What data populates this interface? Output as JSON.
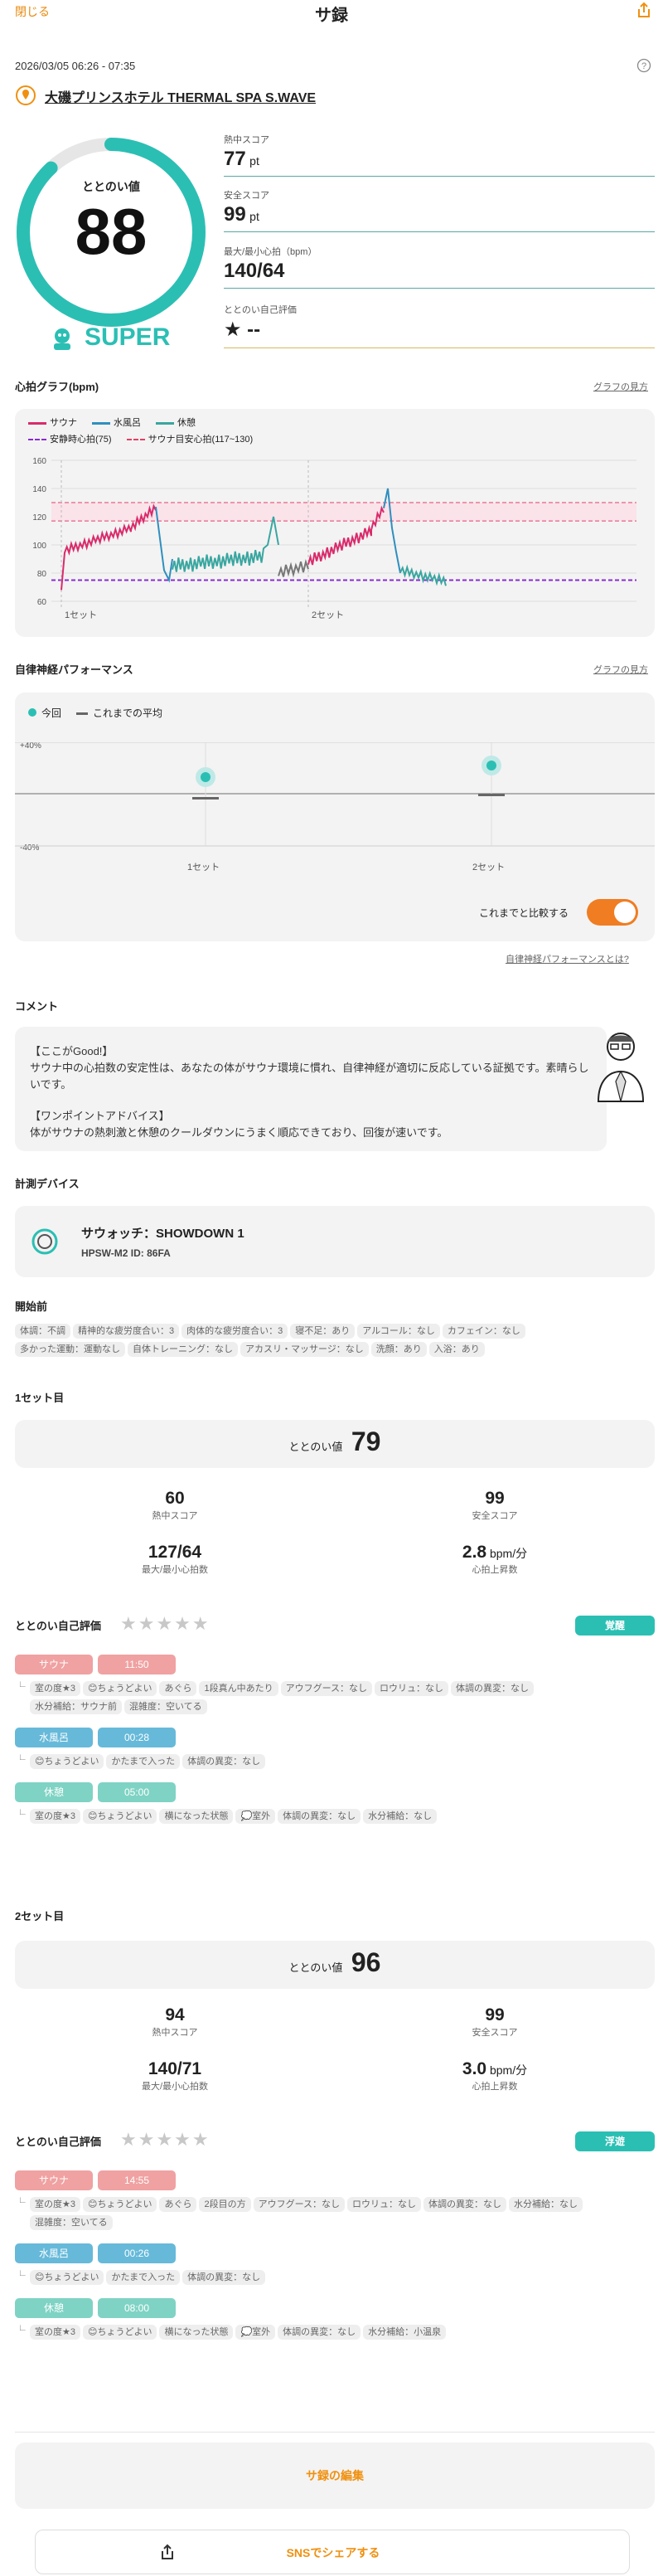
{
  "header": {
    "close": "閉じる",
    "title": "サ録"
  },
  "session": {
    "datetime": "2026/03/05 06:26 - 07:35",
    "facility": "大磯プリンスホテル THERMAL SPA S.WAVE"
  },
  "totonoi": {
    "label": "ととのい値",
    "value": "88",
    "rank": "SUPER",
    "progress": 0.88
  },
  "scores": [
    {
      "label": "熱中スコア",
      "value": "77",
      "unit": "pt",
      "color": "#5aa8a4"
    },
    {
      "label": "安全スコア",
      "value": "99",
      "unit": "pt",
      "color": "#5aa8a4"
    },
    {
      "label": "最大/最小心拍（bpm）",
      "value": "140/64",
      "unit": "",
      "color": "#5aa8a4"
    },
    {
      "label": "ととのい自己評価",
      "value": "★ --",
      "unit": "",
      "color": "#d8b85e"
    }
  ],
  "hr_graph": {
    "title": "心拍グラフ(bpm)",
    "help": "グラフの見方",
    "legend": {
      "sauna": "サウナ",
      "water": "水風呂",
      "rest": "休憩",
      "stable": "安静時心拍(75)",
      "target": "サウナ目安心拍(117~130)"
    },
    "y_ticks": [
      "160",
      "140",
      "120",
      "100",
      "80",
      "60"
    ],
    "set_labels": [
      "1セット",
      "2セット"
    ]
  },
  "ans": {
    "title": "自律神経パフォーマンス",
    "help": "グラフの見方",
    "legend_now": "今回",
    "legend_avg": "これまでの平均",
    "y_top": "+40%",
    "y_bottom": "-40%",
    "sets": [
      "1セット",
      "2セット"
    ],
    "compare": "これまでと比較する",
    "what": "自律神経パフォーマンスとは?"
  },
  "comment": {
    "title": "コメント",
    "good_head": "【ここがGood!】",
    "good_body": "サウナ中の心拍数の安定性は、あなたの体がサウナ環境に慣れ、自律神経が適切に反応している証拠です。素晴らしいです。",
    "advice_head": "【ワンポイントアドバイス】",
    "advice_body": "体がサウナの熱刺激と休憩のクールダウンにうまく順応できており、回復が速いです。"
  },
  "device": {
    "title": "計測デバイス",
    "name": "サウォッチ：SHOWDOWN 1",
    "id": "HPSW-M2  ID: 86FA"
  },
  "before": {
    "title": "開始前",
    "tags": [
      "体調：不調",
      "精神的な疲労度合い：3",
      "肉体的な疲労度合い：3",
      "寝不足：あり",
      "アルコール：なし",
      "カフェイン：なし",
      "多かった運動：運動なし",
      "自体トレーニング：なし",
      "アカスリ・マッサージ：なし",
      "洗顔：あり",
      "入浴：あり"
    ]
  },
  "set1": {
    "title": "1セット目",
    "totonoi_label": "ととのい値",
    "totonoi": "79",
    "stats": [
      {
        "value": "60",
        "unit": "",
        "label": "熱中スコア"
      },
      {
        "value": "99",
        "unit": "",
        "label": "安全スコア"
      },
      {
        "value": "127/64",
        "unit": "",
        "label": "最大/最小心拍数"
      },
      {
        "value": "2.8",
        "unit": " bpm/分",
        "label": "心拍上昇数"
      }
    ],
    "eval_label": "ととのい自己評価",
    "badge": "覚醒",
    "phases": [
      {
        "name": "サウナ",
        "time": "11:50",
        "color": "#f0a1a1",
        "tags": [
          "室の度★3",
          "😊ちょうどよい",
          "あぐら",
          "1段真ん中あたり",
          "アウフグース：なし",
          "ロウリュ：なし",
          "体調の異変：なし",
          "水分補給：サウナ前",
          "混雑度：空いてる"
        ]
      },
      {
        "name": "水風呂",
        "time": "00:28",
        "color": "#66b9d9",
        "tags": [
          "😊ちょうどよい",
          "かたまで入った",
          "体調の異変：なし"
        ]
      },
      {
        "name": "休憩",
        "time": "05:00",
        "color": "#7fd3c4",
        "tags": [
          "室の度★3",
          "😊ちょうどよい",
          "横になった状態",
          "💭室外",
          "体調の異変：なし",
          "水分補給：なし"
        ]
      }
    ]
  },
  "set2": {
    "title": "2セット目",
    "totonoi_label": "ととのい値",
    "totonoi": "96",
    "stats": [
      {
        "value": "94",
        "unit": "",
        "label": "熱中スコア"
      },
      {
        "value": "99",
        "unit": "",
        "label": "安全スコア"
      },
      {
        "value": "140/71",
        "unit": "",
        "label": "最大/最小心拍数"
      },
      {
        "value": "3.0",
        "unit": " bpm/分",
        "label": "心拍上昇数"
      }
    ],
    "eval_label": "ととのい自己評価",
    "badge": "浮遊",
    "phases": [
      {
        "name": "サウナ",
        "time": "14:55",
        "color": "#f0a1a1",
        "tags": [
          "室の度★3",
          "😊ちょうどよい",
          "あぐら",
          "2段目の方",
          "アウフグース：なし",
          "ロウリュ：なし",
          "体調の異変：なし",
          "水分補給：なし",
          "混雑度：空いてる"
        ]
      },
      {
        "name": "水風呂",
        "time": "00:26",
        "color": "#66b9d9",
        "tags": [
          "😊ちょうどよい",
          "かたまで入った",
          "体調の異変：なし"
        ]
      },
      {
        "name": "休憩",
        "time": "08:00",
        "color": "#7fd3c4",
        "tags": [
          "室の度★3",
          "😊ちょうどよい",
          "横になった状態",
          "💭室外",
          "体調の異変：なし",
          "水分補給：小温泉"
        ]
      }
    ]
  },
  "footer": {
    "edit": "サ録の編集",
    "share": "SNSでシェアする"
  },
  "colors": {
    "accent": "#f0900f",
    "teal": "#2bbfb4",
    "sauna": "#d92b6b",
    "water": "#2f8fbf",
    "rest": "#3aa6a0"
  }
}
